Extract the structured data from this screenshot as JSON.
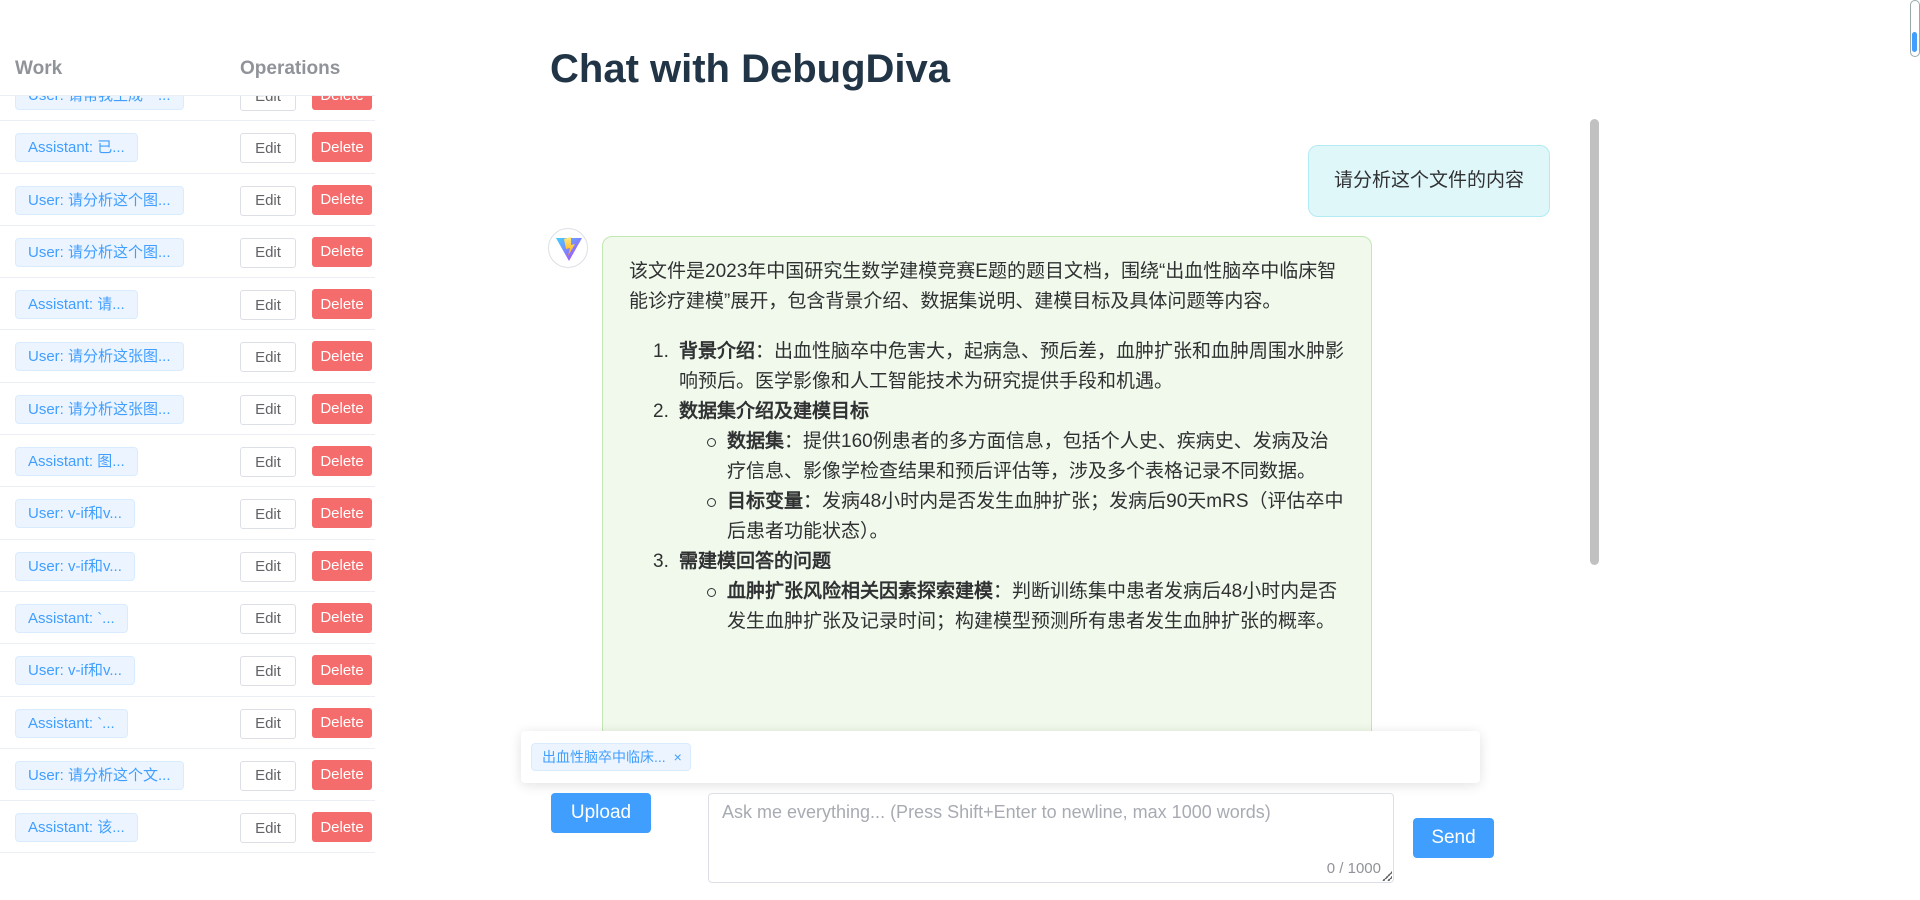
{
  "sidebar": {
    "col_work": "Work",
    "col_ops": "Operations",
    "edit_label": "Edit",
    "delete_label": "Delete",
    "rows": [
      {
        "label": "User: 请帮我生成一..."
      },
      {
        "label": "Assistant: 已..."
      },
      {
        "label": "User: 请分析这个图..."
      },
      {
        "label": "User: 请分析这个图..."
      },
      {
        "label": "Assistant: 请..."
      },
      {
        "label": "User: 请分析这张图..."
      },
      {
        "label": "User: 请分析这张图..."
      },
      {
        "label": "Assistant: 图..."
      },
      {
        "label": "User: v-if和v..."
      },
      {
        "label": "User: v-if和v..."
      },
      {
        "label": "Assistant: `..."
      },
      {
        "label": "User: v-if和v..."
      },
      {
        "label": "Assistant: `..."
      },
      {
        "label": "User: 请分析这个文..."
      },
      {
        "label": "Assistant: 该..."
      }
    ]
  },
  "chat": {
    "title": "Chat with DebugDiva",
    "user_message": "请分析这个文件的内容",
    "assistant": {
      "intro": "该文件是2023年中国研究生数学建模竞赛E题的题目文档，围绕“出血性脑卒中临床智能诊疗建模”展开，包含背景介绍、数据集说明、建模目标及具体问题等内容。",
      "s1_num": "1.",
      "s1_title": "背景介绍",
      "s1_text": "：出血性脑卒中危害大，起病急、预后差，血肿扩张和血肿周围水肿影响预后。医学影像和人工智能技术为研究提供手段和机遇。",
      "s2_num": "2.",
      "s2_title": "数据集介绍及建模目标",
      "s2_b1_title": "数据集",
      "s2_b1_text": "：提供160例患者的多方面信息，包括个人史、疾病史、发病及治疗信息、影像学检查结果和预后评估等，涉及多个表格记录不同数据。",
      "s2_b2_title": "目标变量",
      "s2_b2_text": "：发病48小时内是否发生血肿扩张；发病后90天mRS（评估卒中后患者功能状态）。",
      "s3_num": "3.",
      "s3_title": "需建模回答的问题",
      "s3_b1_title": "血肿扩张风险相关因素探索建模",
      "s3_b1_text": "：判断训练集中患者发病后48小时内是否发生血肿扩张及记录时间；构建模型预测所有患者发生血肿扩张的概率。"
    }
  },
  "attachment": {
    "file_name": "出血性脑卒中临床...",
    "close_glyph": "×"
  },
  "input": {
    "upload_label": "Upload",
    "placeholder": "Ask me everything... (Press Shift+Enter to newline, max 1000 words)",
    "value": "",
    "counter": "0 / 1000",
    "send_label": "Send"
  },
  "icons": {
    "avatar": "vite-logo-icon",
    "chip_close": "close-icon"
  },
  "colors": {
    "primary": "#409eff",
    "danger": "#f56c6c",
    "user_bubble": "#e0f7fa",
    "ai_bubble": "#f0f9eb"
  }
}
